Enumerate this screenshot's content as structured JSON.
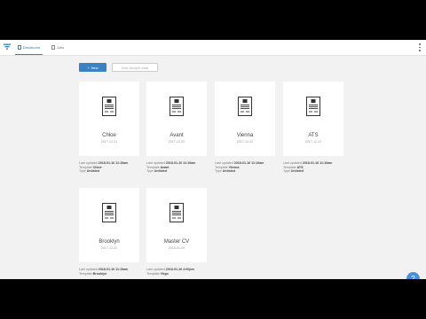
{
  "topbar": {
    "tabs": [
      {
        "label": "Dashboard",
        "active": true
      },
      {
        "label": "Jobs",
        "active": false
      }
    ]
  },
  "actions": {
    "new_label": "New",
    "sample_label": "Add sample data"
  },
  "resumes": [
    {
      "name": "Chloe",
      "date": "2017-12-21",
      "updated": "2018-01-16 11:10am",
      "template": "Chloe",
      "type": "Unlisted"
    },
    {
      "name": "Avant",
      "date": "2017-12-22",
      "updated": "2018-01-16 11:10am",
      "template": "Avant",
      "type": "Unlisted"
    },
    {
      "name": "Vienna",
      "date": "2017-12-22",
      "updated": "2018-01-16 11:10am",
      "template": "Vienna",
      "type": "Unlisted"
    },
    {
      "name": "ATS",
      "date": "2017-12-22",
      "updated": "2018-01-16 11:10am",
      "template": "ATS",
      "type": "Unlisted"
    },
    {
      "name": "Brooklyn",
      "date": "2017-12-22",
      "updated": "2018-01-16 11:10am",
      "template": "Brooklyn",
      "type": ""
    },
    {
      "name": "Master CV",
      "date": "2018-01-09",
      "updated": "2018-01-16 4:00pm",
      "template": "Virgo",
      "type": ""
    }
  ],
  "labels": {
    "last_updated": "Last updated",
    "template": "Template",
    "type": "Type"
  },
  "help": {
    "label": "?"
  },
  "colors": {
    "accent": "#3b82c4",
    "background": "#f2f2f2"
  }
}
